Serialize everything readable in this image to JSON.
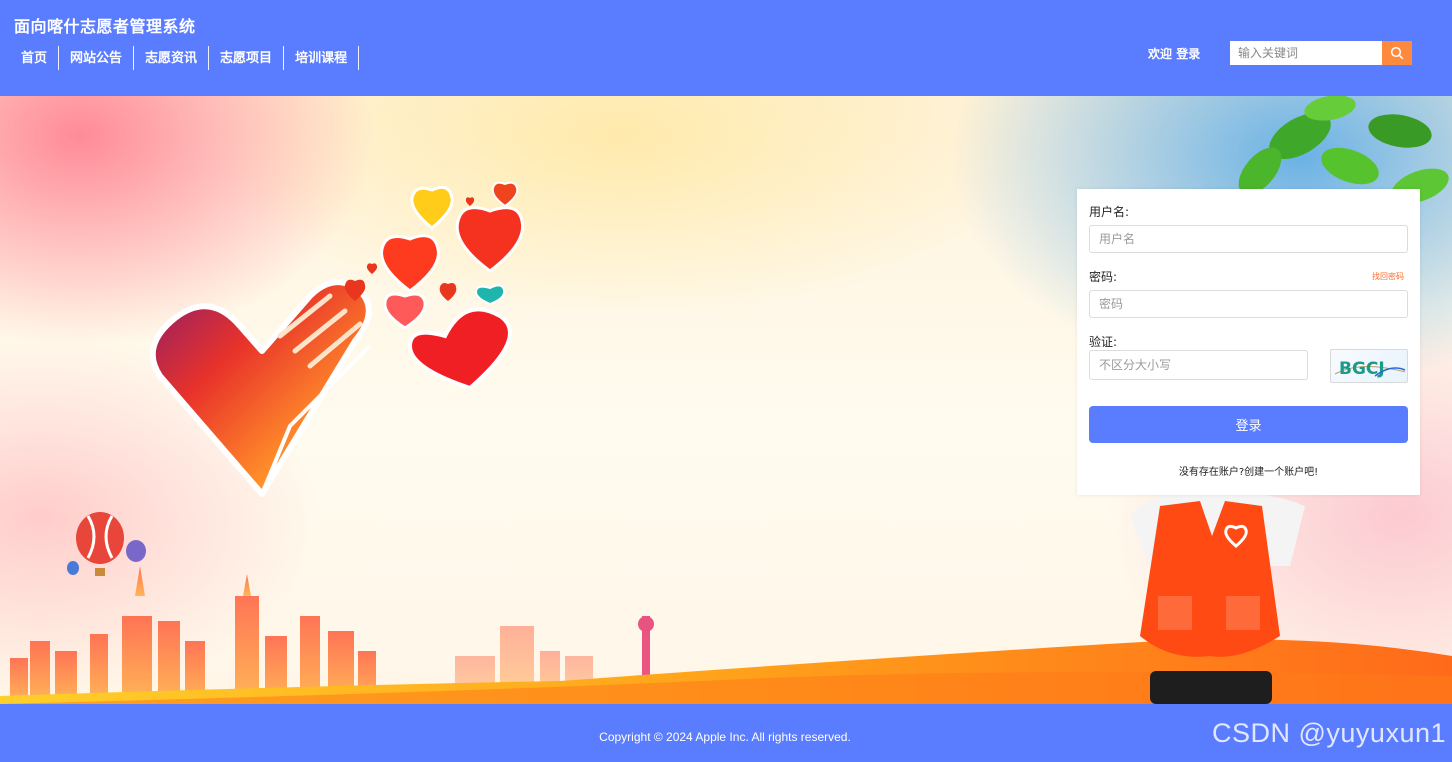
{
  "header": {
    "site_title": "面向喀什志愿者管理系统",
    "nav": [
      "首页",
      "网站公告",
      "志愿资讯",
      "志愿项目",
      "培训课程"
    ],
    "welcome_text": "欢迎",
    "login_link": "登录",
    "search": {
      "placeholder": "输入关键词",
      "value": "",
      "icon": "search-icon"
    }
  },
  "login": {
    "username_label": "用户名:",
    "username_placeholder": "用户名",
    "password_label": "密码:",
    "password_placeholder": "密码",
    "forgot_password": "找回密码",
    "captcha_label": "验证:",
    "captcha_placeholder": "不区分大小写",
    "captcha_text": "BGCJ",
    "login_button": "登录",
    "register_text": "没有存在账户?创建一个账户吧!"
  },
  "footer": {
    "copyright": "Copyright © 2024 Apple Inc. All rights reserved.",
    "watermark": "CSDN @yuyuxun1"
  },
  "colors": {
    "primary": "#5a7cff",
    "search_button": "#ff8a3d",
    "forgot_link": "#ff6a2a"
  }
}
